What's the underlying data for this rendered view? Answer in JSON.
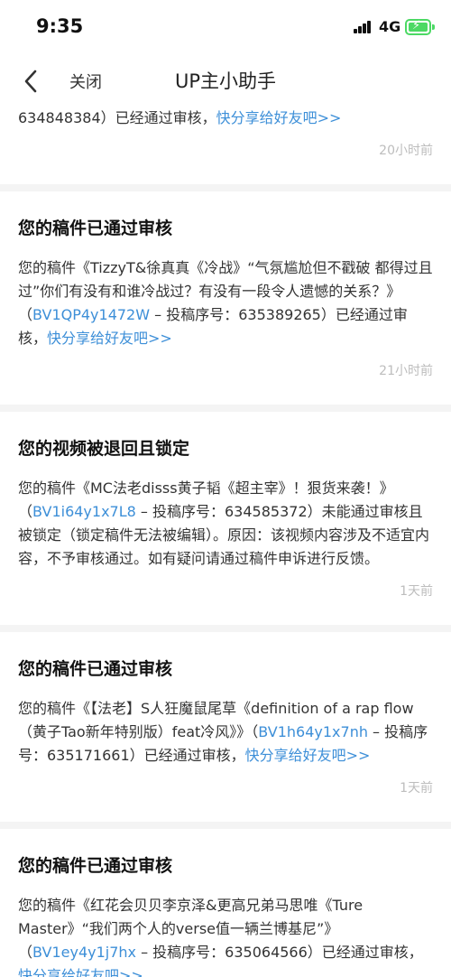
{
  "status_bar": {
    "time": "9:35",
    "network": "4G"
  },
  "nav": {
    "close_label": "关闭",
    "title": "UP主小助手"
  },
  "messages": [
    {
      "partial": true,
      "body_prefix": "634848384）已经通过审核，",
      "share_link": "快分享给好友吧>>",
      "time": "20小时前"
    },
    {
      "title": "您的稿件已通过审核",
      "body_prefix": "您的稿件《TizzyT&徐真真《冷战》“气氛尴尬但不戳破 都得过且过”你们有没有和谁冷战过？有没有一段令人遗憾的关系？》（",
      "bv": "BV1QP4y1472W",
      "body_middle": " – 投稿序号：635389265）已经通过审核，",
      "share_link": "快分享给好友吧>>",
      "time": "21小时前"
    },
    {
      "title": "您的视频被退回且锁定",
      "body_prefix": "您的稿件《MC法老disss黄子韬《超主宰》！狠货来袭！》（",
      "bv": "BV1i64y1x7L8",
      "body_middle": " – 投稿序号：634585372）未能通过审核且被锁定（锁定稿件无法被编辑）。原因：该视频内容涉及不适宜内容，不予审核通过。如有疑问请通过稿件申诉进行反馈。",
      "share_link": "",
      "time": "1天前"
    },
    {
      "title": "您的稿件已通过审核",
      "body_prefix": "您的稿件《【法老】S人狂魔鼠尾草《definition of a rap flow（黄子Tao新年特别版）feat冷风》》（",
      "bv": "BV1h64y1x7nh",
      "body_middle": " – 投稿序号：635171661）已经通过审核，",
      "share_link": "快分享给好友吧>>",
      "time": "1天前"
    },
    {
      "title": "您的稿件已通过审核",
      "body_prefix": "您的稿件《红花会贝贝李京泽&更高兄弟马思唯《Ture Master》“我们两个人的verse值一辆兰博基尼”》（",
      "bv": "BV1ey4y1j7hx",
      "body_middle": " – 投稿序号：635064566）已经通过审核，",
      "share_link": "快分享给好友吧>>",
      "time": ""
    }
  ]
}
